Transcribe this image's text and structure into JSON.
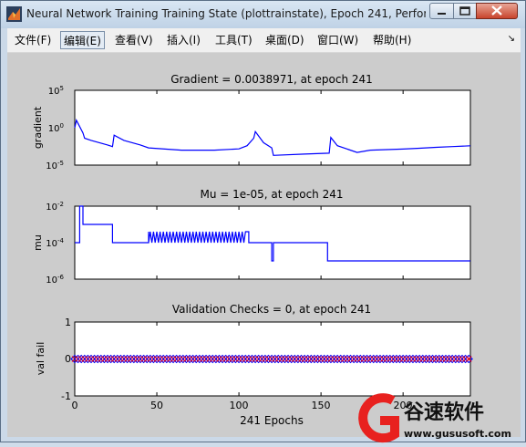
{
  "window": {
    "title": "Neural Network Training Training State (plottrainstate), Epoch 241, Perfor...",
    "controls": [
      "minimize",
      "maximize",
      "close"
    ]
  },
  "menubar": {
    "items": [
      {
        "label": "文件(F)"
      },
      {
        "label": "编辑(E)",
        "active": true
      },
      {
        "label": "查看(V)"
      },
      {
        "label": "插入(I)"
      },
      {
        "label": "工具(T)"
      },
      {
        "label": "桌面(D)"
      },
      {
        "label": "窗口(W)"
      },
      {
        "label": "帮助(H)"
      }
    ],
    "overflow_icon": "chevron-icon"
  },
  "plots": {
    "gradient": {
      "title": "Gradient = 0.0038971, at epoch 241",
      "ylabel": "gradient"
    },
    "mu": {
      "title": "Mu = 1e-05, at epoch 241",
      "ylabel": "mu"
    },
    "val": {
      "title": "Validation Checks = 0, at epoch 241",
      "ylabel": "val fail"
    },
    "xlabel": "241 Epochs"
  },
  "watermark": {
    "cn": "谷速软件",
    "url": "www.gususoft.com"
  },
  "colors": {
    "line": "#0000ff",
    "marker": "#ff0000",
    "axes_bg": "#ffffff",
    "figure_bg": "#cccccc"
  },
  "chart_data": [
    {
      "type": "line",
      "title": "Gradient = 0.0038971, at epoch 241",
      "ylabel": "gradient",
      "yscale": "log",
      "xlim": [
        0,
        241
      ],
      "ylim": [
        1e-05,
        100000.0
      ],
      "ytick_labels": [
        "10^-5",
        "10^0",
        "10^5"
      ],
      "x": [
        0,
        1,
        5,
        6,
        10,
        20,
        23,
        24,
        30,
        40,
        45,
        65,
        85,
        100,
        105,
        109,
        110,
        115,
        120,
        121,
        140,
        155,
        156,
        160,
        172,
        180,
        190,
        200,
        210,
        220,
        230,
        241
      ],
      "y": [
        1,
        10,
        0.2,
        0.04,
        0.02,
        0.005,
        0.003,
        0.1,
        0.02,
        0.005,
        0.002,
        0.001,
        0.001,
        0.0015,
        0.004,
        0.04,
        0.3,
        0.01,
        0.002,
        0.0002,
        0.0003,
        0.0004,
        0.05,
        0.004,
        0.0005,
        0.001,
        0.0012,
        0.0014,
        0.0018,
        0.0024,
        0.003,
        0.0039
      ]
    },
    {
      "type": "line",
      "title": "Mu = 1e-05, at epoch 241",
      "ylabel": "mu",
      "yscale": "log",
      "xlim": [
        0,
        241
      ],
      "ylim": [
        1e-06,
        0.01
      ],
      "ytick_labels": [
        "10^-6",
        "10^-4",
        "10^-2"
      ],
      "x": [
        0,
        3,
        5,
        22,
        23,
        44,
        45,
        105,
        106,
        119,
        120,
        121,
        122,
        153,
        154,
        241
      ],
      "y": [
        0.0001,
        0.01,
        0.001,
        0.001,
        0.0001,
        0.0001,
        0.0004,
        0.0004,
        0.0001,
        0.0001,
        1e-05,
        0.0001,
        0.0001,
        0.0001,
        1e-05,
        1e-05
      ]
    },
    {
      "type": "scatter",
      "title": "Validation Checks = 0, at epoch 241",
      "ylabel": "val fail",
      "xlabel": "241 Epochs",
      "xlim": [
        0,
        241
      ],
      "ylim": [
        -1,
        1
      ],
      "xtick_labels": [
        "0",
        "50",
        "100",
        "150",
        "200"
      ],
      "ytick_labels": [
        "-1",
        "0",
        "1"
      ],
      "series": [
        {
          "x_start": 0,
          "x_end": 241,
          "y": 0
        }
      ]
    }
  ]
}
